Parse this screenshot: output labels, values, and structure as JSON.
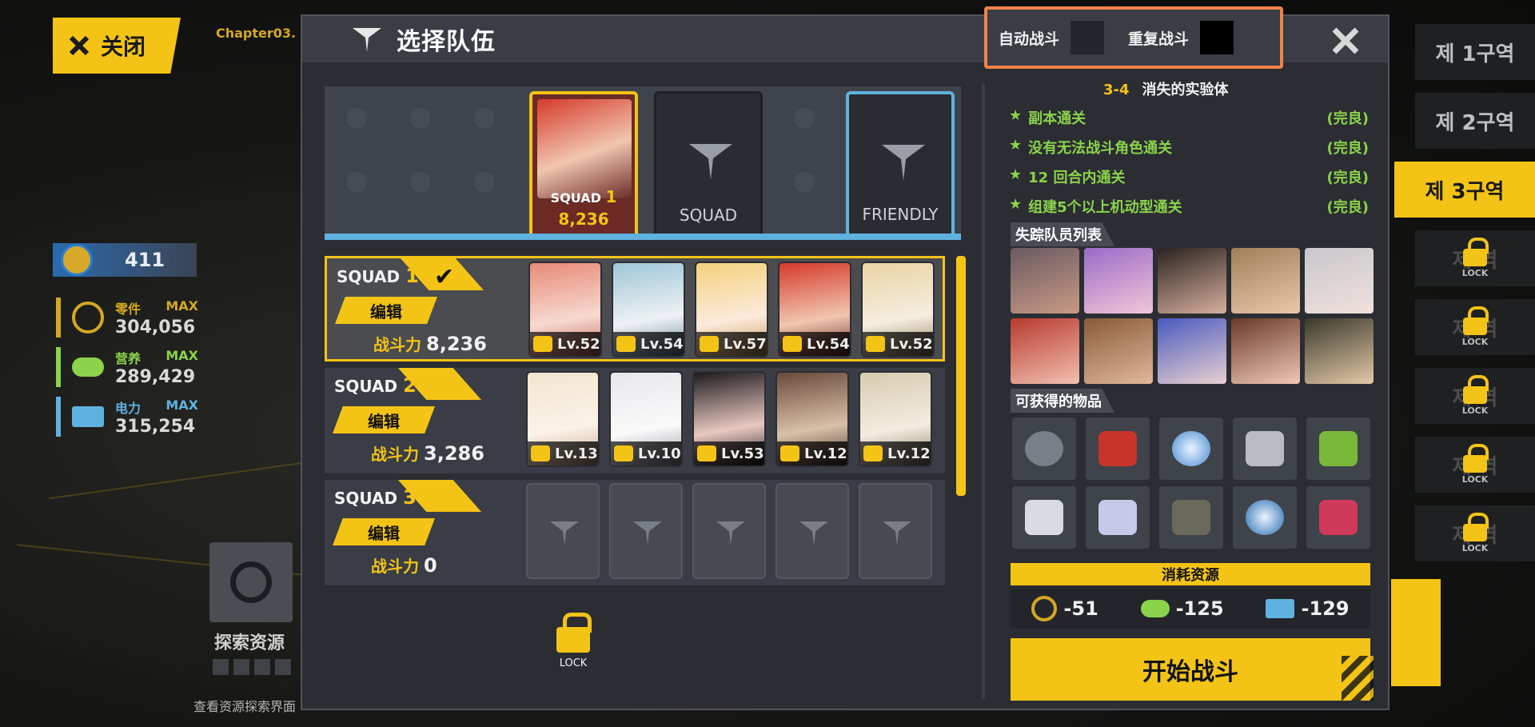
{
  "background": {
    "close_label": "关闭",
    "chapter_tag": "Chapter03.",
    "rank_value": "411",
    "resources": [
      {
        "name": "零件",
        "max": "MAX",
        "value": "304,056",
        "color": "#d3a822"
      },
      {
        "name": "营养",
        "max": "MAX",
        "value": "289,429",
        "color": "#8bd34a"
      },
      {
        "name": "电力",
        "max": "MAX",
        "value": "315,254",
        "color": "#5fb2df"
      }
    ],
    "explore_label": "探索资源",
    "explore_hint": "查看资源探索界面",
    "zones": [
      "제 1구역",
      "제 2구역",
      "제 3구역"
    ],
    "zone_prefix_locked": "제",
    "zone_suffix_locked": "역",
    "lock_label": "LOCK"
  },
  "dialog": {
    "title": "选择队伍",
    "auto_battle": "自动战斗",
    "repeat_battle": "重复战斗",
    "formation": {
      "main_squad": "SQUAD",
      "main_squad_num": "1",
      "main_power": "8,236",
      "empty_label": "SQUAD",
      "friendly_label": "FRIENDLY"
    },
    "squads": [
      {
        "name": "SQUAD",
        "num": "1",
        "edit": "编辑",
        "power_label": "战斗力",
        "power": "8,236",
        "levels": [
          "Lv.52",
          "Lv.54",
          "Lv.57",
          "Lv.54",
          "Lv.52"
        ]
      },
      {
        "name": "SQUAD",
        "num": "2",
        "edit": "编辑",
        "power_label": "战斗力",
        "power": "3,286",
        "levels": [
          "Lv.13",
          "Lv.10",
          "Lv.53",
          "Lv.12",
          "Lv.12"
        ]
      },
      {
        "name": "SQUAD",
        "num": "3",
        "edit": "编辑",
        "power_label": "战斗力",
        "power": "0",
        "levels": []
      }
    ],
    "lock_label": "LOCK",
    "stage": {
      "code": "3-4",
      "name": "消失的实验体"
    },
    "objectives": [
      {
        "text": "副本通关",
        "status": "(完良)"
      },
      {
        "text": "没有无法战斗角色通关",
        "status": "(完良)"
      },
      {
        "text": "12 回合内通关",
        "status": "(完良)"
      },
      {
        "text": "组建5个以上机动型通关",
        "status": "(完良)"
      }
    ],
    "missing_title": "失踪队员列表",
    "items_title": "可获得的物品",
    "cost_title": "消耗资源",
    "costs": [
      {
        "value": "-51",
        "color": "#d3a822"
      },
      {
        "value": "-125",
        "color": "#8bd34a"
      },
      {
        "value": "-129",
        "color": "#5fb2df"
      }
    ],
    "start_label": "开始战斗"
  }
}
